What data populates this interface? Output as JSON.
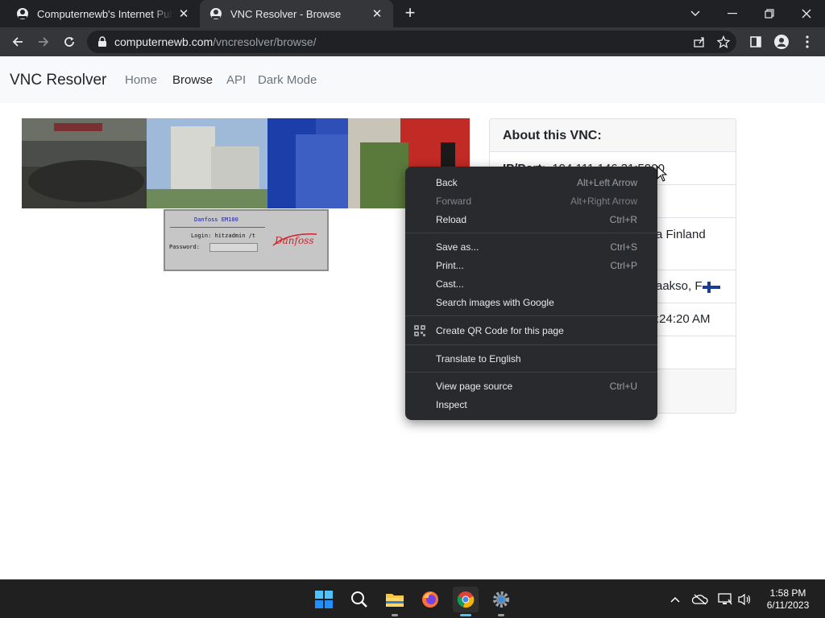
{
  "browser": {
    "tabs": [
      {
        "title": "Computernewb's Internet Pub Hu",
        "active": false
      },
      {
        "title": "VNC Resolver - Browse",
        "active": true
      }
    ],
    "url_host": "computernewb.com",
    "url_path": "/vncresolver/browse/"
  },
  "navbar": {
    "brand": "VNC Resolver",
    "links": [
      {
        "label": "Home",
        "active": false
      },
      {
        "label": "Browse",
        "active": true
      },
      {
        "label": "API",
        "active": false
      },
      {
        "label": "Dark Mode",
        "active": false
      }
    ]
  },
  "screenshot": {
    "window_title": "Danfoss EM100",
    "login_line": "Login:  hitzadmin /t",
    "password_label": "Password:",
    "logo_text": "Danfoss"
  },
  "card": {
    "header": "About this VNC:",
    "ip_label": "IP/Port:",
    "ip_value": "194.111.146.31:5900",
    "country_text": "a Finland",
    "city_text": "aakso, FI",
    "time_text": ":24:20 AM"
  },
  "context_menu": {
    "items": [
      {
        "label": "Back",
        "shortcut": "Alt+Left Arrow",
        "disabled": false
      },
      {
        "label": "Forward",
        "shortcut": "Alt+Right Arrow",
        "disabled": true
      },
      {
        "label": "Reload",
        "shortcut": "Ctrl+R",
        "disabled": false
      },
      {
        "label": "Save as...",
        "shortcut": "Ctrl+S",
        "disabled": false
      },
      {
        "label": "Print...",
        "shortcut": "Ctrl+P",
        "disabled": false
      },
      {
        "label": "Cast...",
        "shortcut": "",
        "disabled": false
      },
      {
        "label": "Search images with Google",
        "shortcut": "",
        "disabled": false
      },
      {
        "label": "Create QR Code for this page",
        "shortcut": "",
        "disabled": false
      },
      {
        "label": "Translate to English",
        "shortcut": "",
        "disabled": false
      },
      {
        "label": "View page source",
        "shortcut": "Ctrl+U",
        "disabled": false
      },
      {
        "label": "Inspect",
        "shortcut": "",
        "disabled": false
      }
    ]
  },
  "taskbar": {
    "time": "1:58 PM",
    "date": "6/11/2023"
  },
  "colors": {
    "tab_strip": "#202124",
    "toolbar": "#35363a",
    "menu_bg": "#292a2d",
    "navbar_bg": "#f8f9fa",
    "taskbar_bg": "#202020"
  }
}
